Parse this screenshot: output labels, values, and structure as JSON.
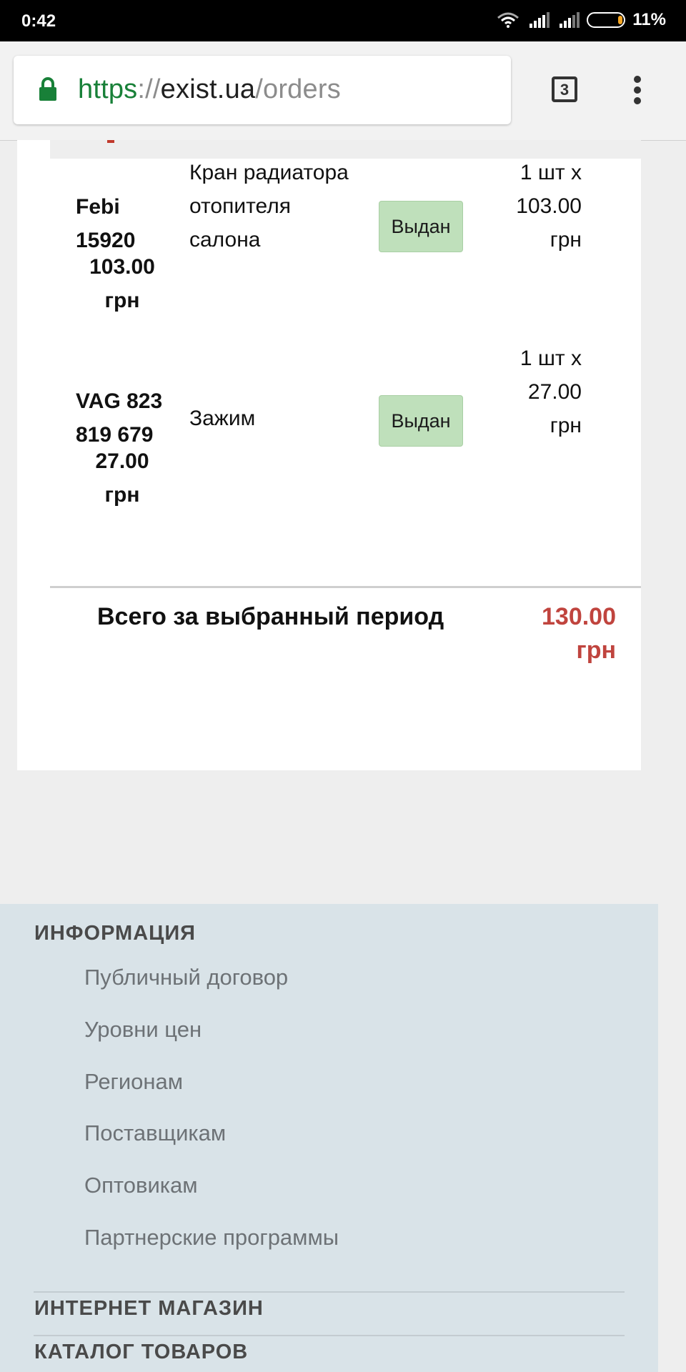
{
  "status_bar": {
    "time": "0:42",
    "battery": "11%"
  },
  "browser": {
    "url_scheme": "https",
    "url_sep": "://",
    "url_host": "exist.ua",
    "url_path": "/orders",
    "tab_count": "3"
  },
  "orders": [
    {
      "code_line1": "Febi",
      "code_line2": "15920",
      "price_line1": "103.00",
      "price_line2": "грн",
      "name": [
        "Кран радиатора",
        "отопителя",
        "салона"
      ],
      "status": "Выдан",
      "qty": [
        "1 шт х",
        "103.00",
        "грн"
      ]
    },
    {
      "code_line1": "VAG 823",
      "code_line2": "819 679",
      "price_line1": "27.00",
      "price_line2": "грн",
      "name": [
        "Зажим"
      ],
      "status": "Выдан",
      "qty": [
        "1 шт х",
        "27.00",
        "грн"
      ]
    }
  ],
  "total": {
    "label": "Всего за выбранный период",
    "value_line1": "130.00",
    "value_line2": "грн"
  },
  "footer": {
    "info_title": "ИНФОРМАЦИЯ",
    "links": [
      "Публичный договор",
      "Уровни цен",
      "Регионам",
      "Поставщикам",
      "Оптовикам",
      "Партнерские программы"
    ],
    "shop_title": "ИНТЕРНЕТ МАГАЗИН",
    "catalog_title": "КАТАЛОГ ТОВАРОВ"
  },
  "colors": {
    "accent_red": "#c0443e",
    "status_green": "#bfe0bb",
    "url_green": "#188038"
  }
}
